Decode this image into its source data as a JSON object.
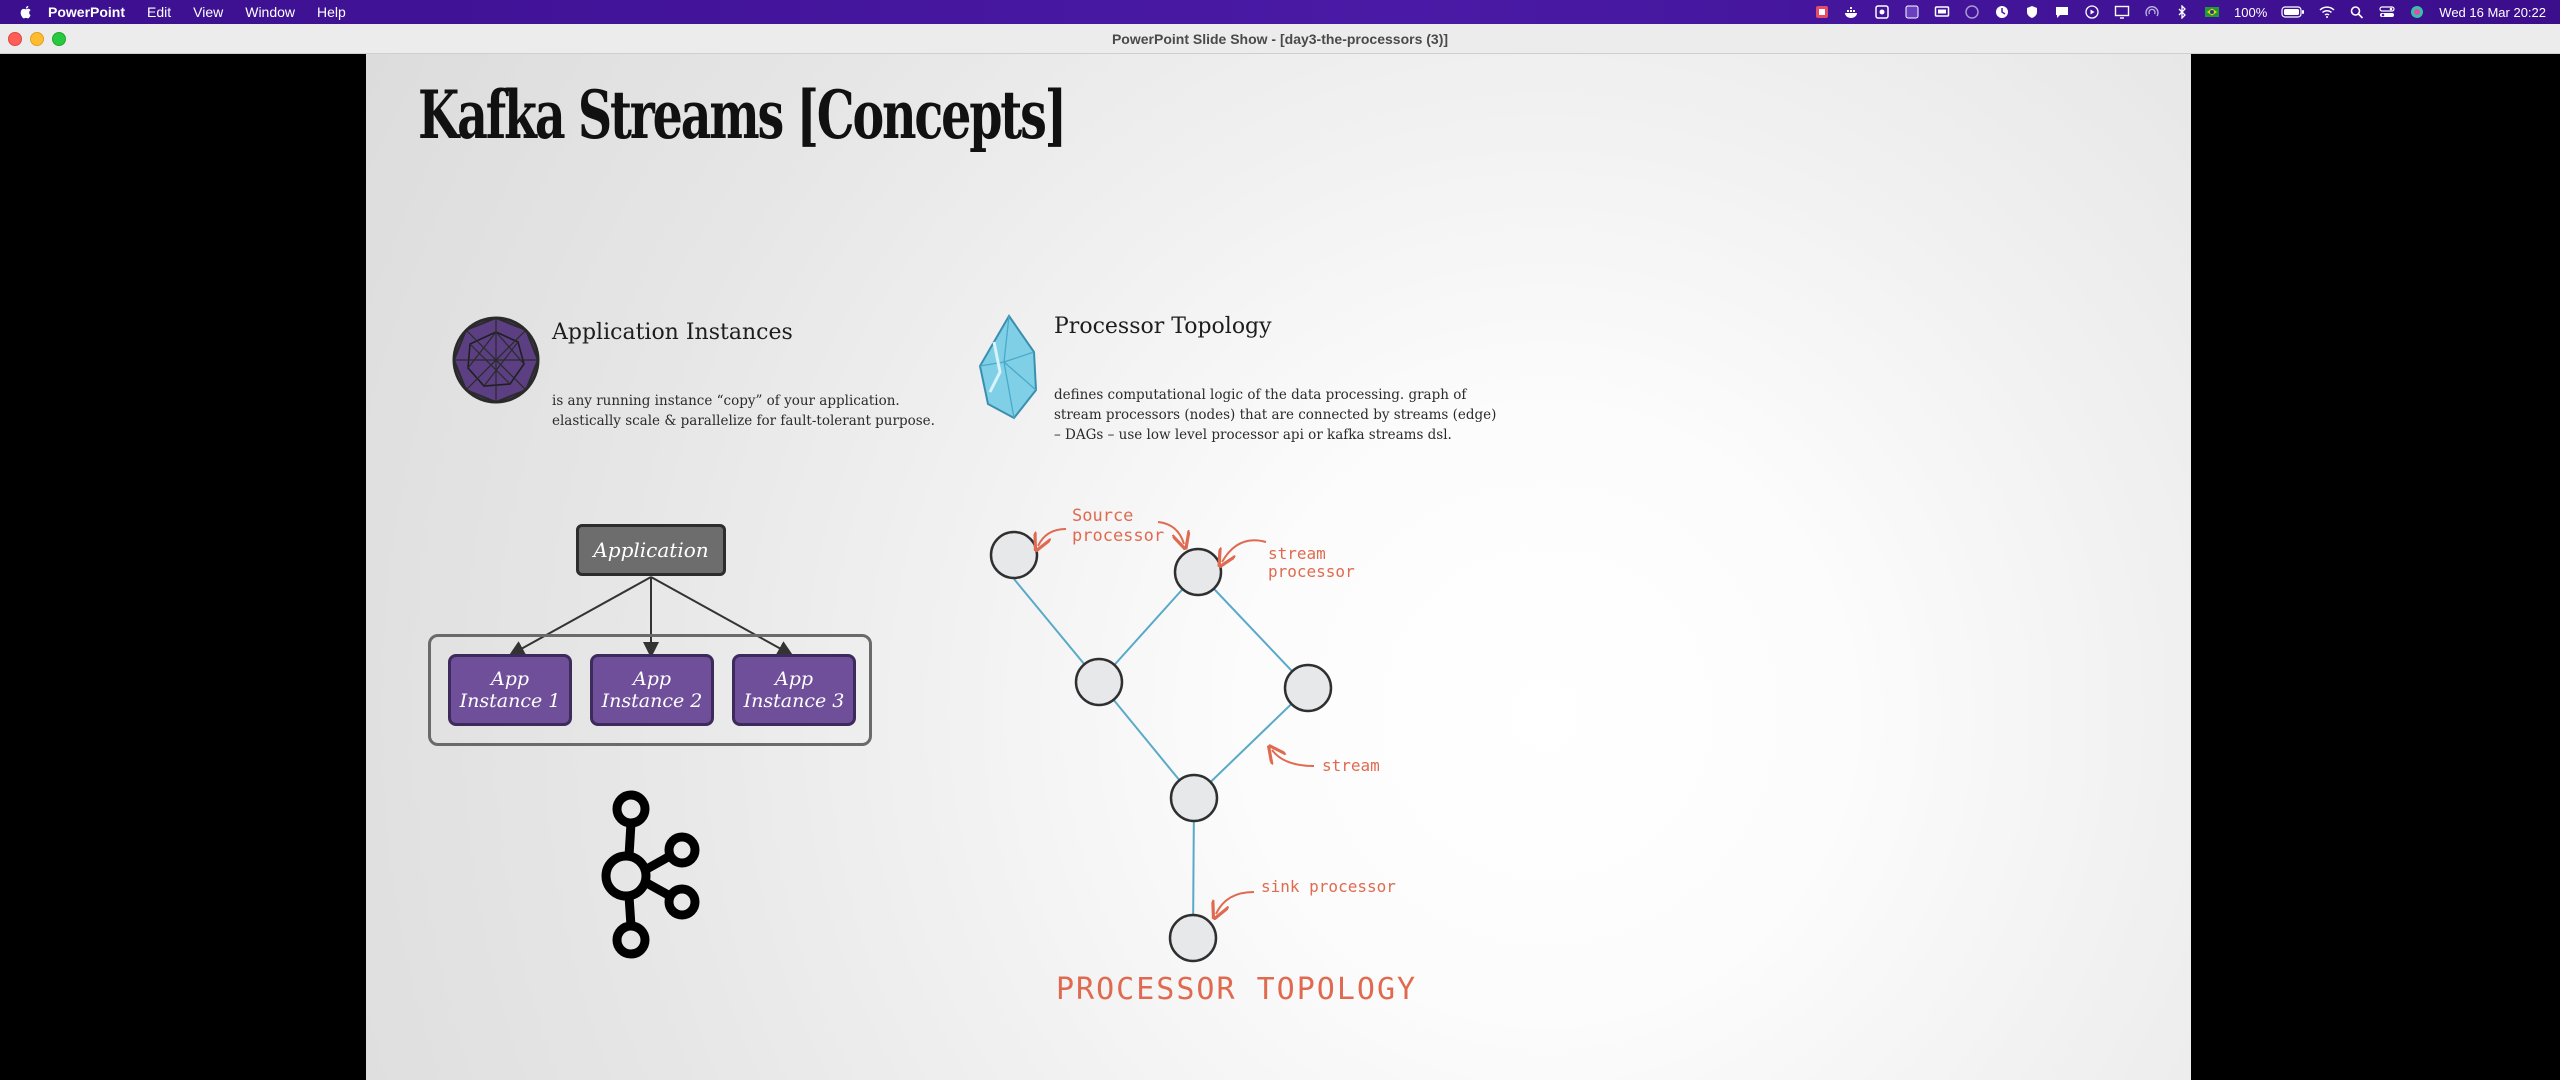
{
  "menubar": {
    "app_name": "PowerPoint",
    "menus": [
      "Edit",
      "View",
      "Window",
      "Help"
    ],
    "battery_percent": "100%",
    "datetime": "Wed 16 Mar  20:22",
    "tray_icons": [
      "notion-icon",
      "docker-icon",
      "app-icon",
      "app-icon",
      "screen-icon",
      "moon-icon",
      "clock-icon",
      "shield-icon",
      "chat-icon",
      "play-icon",
      "display-icon",
      "airdrop-icon",
      "bluetooth-icon",
      "flag-icon",
      "battery-icon",
      "wifi-icon",
      "search-icon",
      "control-center-icon",
      "siri-icon"
    ]
  },
  "window": {
    "title": "PowerPoint Slide Show - [day3-the-processors (3)]"
  },
  "slide": {
    "title": "Kafka Streams [Concepts]",
    "app_instances": {
      "heading": "Application Instances",
      "line1": "is any running instance “copy” of your application.",
      "line2": "elastically scale & parallelize for fault-tolerant purpose."
    },
    "processor_topology": {
      "heading": "Processor Topology",
      "line1": "defines computational logic of the data processing. graph of",
      "line2": "stream processors (nodes) that are connected by streams (edge)",
      "line3": "– DAGs – use low level processor api or kafka streams dsl."
    },
    "diagram": {
      "application_label": "Application",
      "instances": [
        "App Instance 1",
        "App Instance 2",
        "App Instance 3"
      ]
    },
    "topology": {
      "source_label_1": "Source",
      "source_label_2": "processor",
      "stream_processor_1": "stream",
      "stream_processor_2": "processor",
      "stream_label": "stream",
      "sink_label": "sink processor",
      "caption": "PROCESSOR TOPOLOGY"
    }
  },
  "colors": {
    "menubar": "#4a1aa6",
    "instance_fill": "#6f4f99",
    "application_fill": "#6d6d6d",
    "annotation": "#e06a50",
    "edge": "#5aa9c9"
  }
}
